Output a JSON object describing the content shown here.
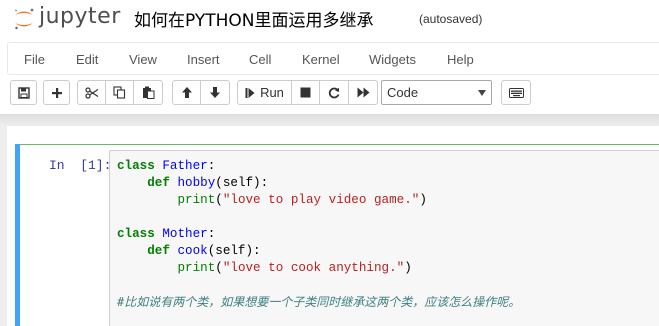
{
  "header": {
    "logo_text": "jupyter",
    "notebook_title": "如何在PYTHON里面运用多继承",
    "save_status": "(autosaved)"
  },
  "menu": [
    "File",
    "Edit",
    "View",
    "Insert",
    "Cell",
    "Kernel",
    "Widgets",
    "Help"
  ],
  "toolbar": {
    "run_label": "Run",
    "cell_type_value": "Code",
    "cell_type_options": [
      "Code"
    ]
  },
  "cell": {
    "prompt": "In  [1]:",
    "code_lines": [
      [
        {
          "t": "class ",
          "c": "kw"
        },
        {
          "t": "Father",
          "c": "def"
        },
        {
          "t": ":",
          "c": ""
        }
      ],
      [
        {
          "t": "    ",
          "c": ""
        },
        {
          "t": "def ",
          "c": "kw"
        },
        {
          "t": "hobby",
          "c": "def"
        },
        {
          "t": "(self):",
          "c": ""
        }
      ],
      [
        {
          "t": "        ",
          "c": ""
        },
        {
          "t": "print",
          "c": "builtin"
        },
        {
          "t": "(",
          "c": ""
        },
        {
          "t": "\"love to play video game.\"",
          "c": "str"
        },
        {
          "t": ")",
          "c": ""
        }
      ],
      [],
      [
        {
          "t": "class ",
          "c": "kw"
        },
        {
          "t": "Mother",
          "c": "def"
        },
        {
          "t": ":",
          "c": ""
        }
      ],
      [
        {
          "t": "    ",
          "c": ""
        },
        {
          "t": "def ",
          "c": "kw"
        },
        {
          "t": "cook",
          "c": "def"
        },
        {
          "t": "(self):",
          "c": ""
        }
      ],
      [
        {
          "t": "        ",
          "c": ""
        },
        {
          "t": "print",
          "c": "builtin"
        },
        {
          "t": "(",
          "c": ""
        },
        {
          "t": "\"love to cook anything.\"",
          "c": "str"
        },
        {
          "t": ")",
          "c": ""
        }
      ],
      [],
      [
        {
          "t": "#比如说有两个类，如果想要一个子类同时继承这两个类，应该怎么操作呢。",
          "c": "cmt"
        }
      ]
    ]
  },
  "colors": {
    "selected_cell_border": "#66bb6a",
    "cell_left_bar": "#42a5f5",
    "prompt": "#303f9f",
    "logo_orange": "#f37726"
  }
}
